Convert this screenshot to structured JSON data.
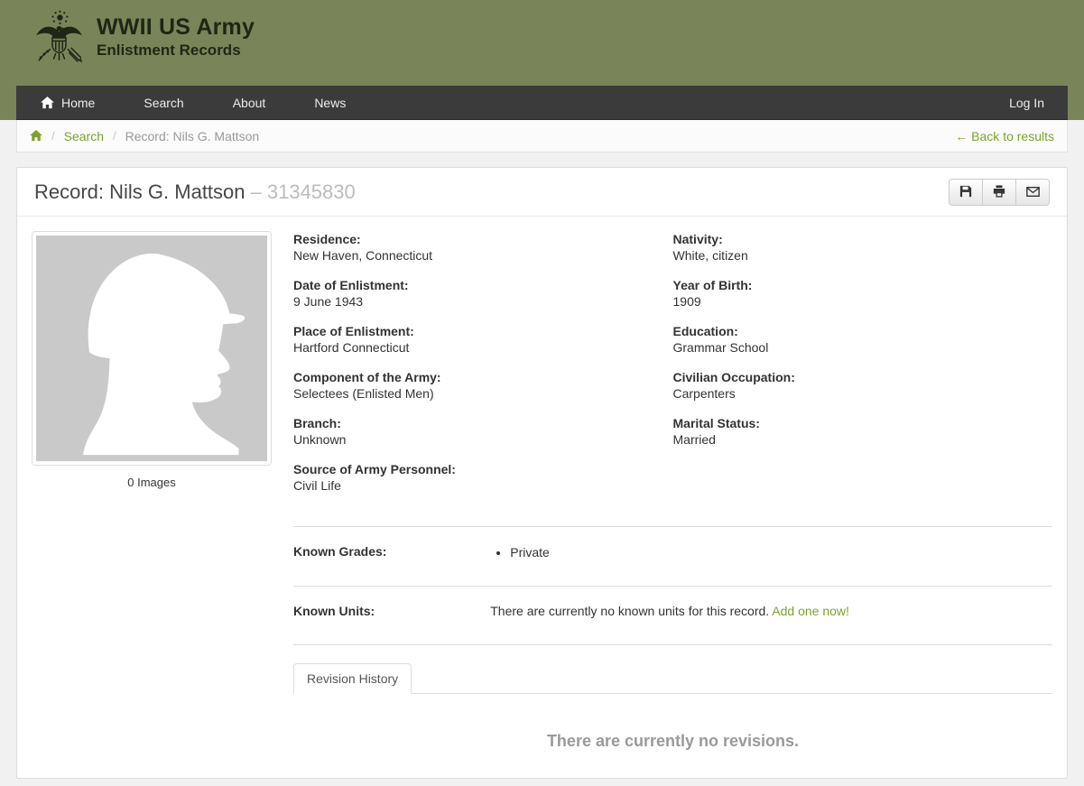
{
  "header": {
    "brand_title": "WWII US Army",
    "brand_subtitle": "Enlistment Records",
    "nav_items": [
      "Home",
      "Search",
      "About",
      "News"
    ],
    "login_label": "Log In"
  },
  "breadcrumb": {
    "separator": "/",
    "search_label": "Search",
    "current": "Record: Nils G. Mattson",
    "back_label": "← Back to results"
  },
  "record": {
    "title": "Record: Nils G. Mattson",
    "serial": "– 31345830",
    "images_caption": "0 Images",
    "fields_left": [
      {
        "label": "Residence:",
        "value": "New Haven, Connecticut"
      },
      {
        "label": "Date of Enlistment:",
        "value": "9 June 1943"
      },
      {
        "label": "Place of Enlistment:",
        "value": "Hartford Connecticut"
      },
      {
        "label": "Component of the Army:",
        "value": "Selectees (Enlisted Men)"
      },
      {
        "label": "Branch:",
        "value": "Unknown"
      },
      {
        "label": "Source of Army Personnel:",
        "value": "Civil Life"
      }
    ],
    "fields_right": [
      {
        "label": "Nativity:",
        "value": "White, citizen"
      },
      {
        "label": "Year of Birth:",
        "value": "1909"
      },
      {
        "label": "Education:",
        "value": "Grammar School"
      },
      {
        "label": "Civilian Occupation:",
        "value": "Carpenters"
      },
      {
        "label": "Marital Status:",
        "value": "Married"
      }
    ],
    "known_grades": {
      "label": "Known Grades:",
      "items": [
        "Private"
      ]
    },
    "known_units": {
      "label": "Known Units:",
      "text": "There are currently no known units for this record.",
      "link_label": "Add one now!"
    },
    "tab_label": "Revision History",
    "revisions_empty": "There are currently no revisions."
  },
  "icons": {
    "brand": "army-seal-icon",
    "nav_home": "home-icon",
    "breadcrumb_home": "home-icon",
    "actions": [
      "save-icon",
      "print-icon",
      "email-icon"
    ]
  },
  "colors": {
    "olive_header": "#798558",
    "navbar_bg": "#3b3b3b",
    "accent_green": "#7ca22b",
    "page_bg": "#f1f1f1",
    "card_border": "#dcdcdc",
    "muted_text": "#9a9a9a",
    "placeholder_gray": "#c9c9c9"
  }
}
